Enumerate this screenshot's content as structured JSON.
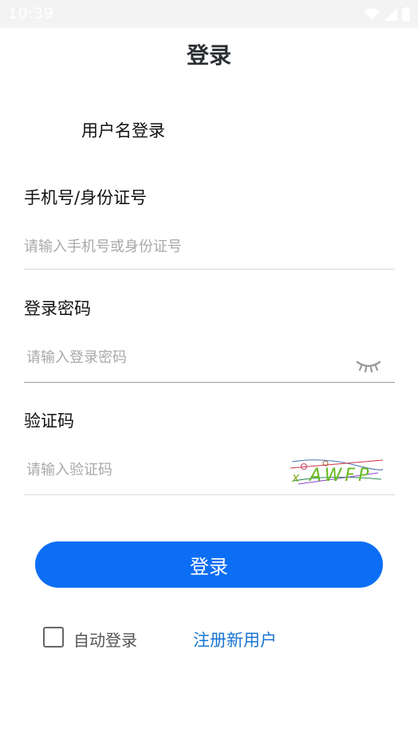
{
  "status_bar": {
    "time": "10:39"
  },
  "header": {
    "title": "登录"
  },
  "tabs": {
    "username_login": "用户名登录"
  },
  "form": {
    "account": {
      "label": "手机号/身份证号",
      "placeholder": "请输入手机号或身份证号"
    },
    "password": {
      "label": "登录密码",
      "placeholder": "请输入登录密码"
    },
    "captcha": {
      "label": "验证码",
      "placeholder": "请输入验证码",
      "image_text": "AWFP"
    }
  },
  "actions": {
    "login_button": "登录",
    "auto_login_label": "自动登录",
    "auto_login_checked": false,
    "register_link": "注册新用户"
  },
  "icons": {
    "wifi": "wifi-icon",
    "signal": "signal-icon",
    "battery": "battery-icon",
    "eye": "eye-closed-icon"
  },
  "colors": {
    "primary": "#0c6ef5",
    "link": "#1a75d2",
    "status_bar_bg": "#f3f3f3"
  }
}
